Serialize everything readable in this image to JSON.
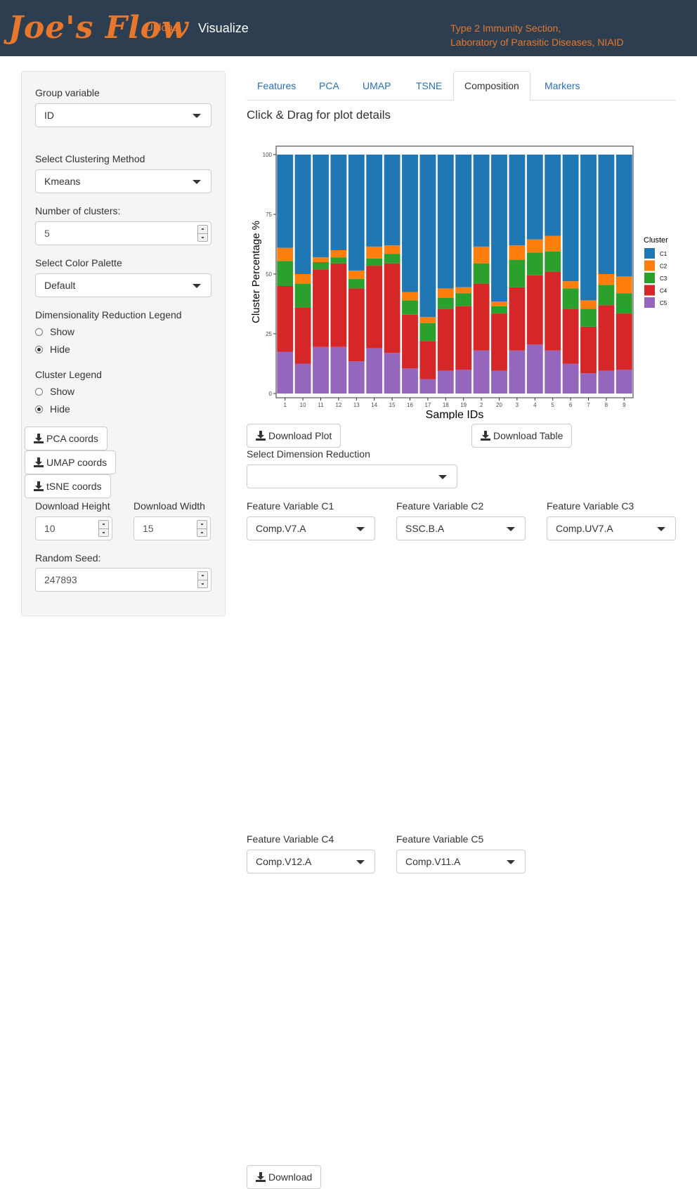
{
  "navbar": {
    "brand": "Joe's Flow",
    "upload": "Upload",
    "visualize": "Visualize",
    "org_line1": "Type 2 Immunity Section,",
    "org_line2": "Laboratory of Parasitic Diseases, NIAID"
  },
  "sidebar": {
    "group_label": "Group variable",
    "group_value": "ID",
    "clustering_label": "Select Clustering Method",
    "clustering_value": "Kmeans",
    "nclusters_label": "Number of clusters:",
    "nclusters_value": "5",
    "palette_label": "Select Color Palette",
    "palette_value": "Default",
    "dimred_legend_label": "Dimensionality Reduction Legend",
    "dimred_legend_options": [
      "Show",
      "Hide"
    ],
    "dimred_legend_selected": "Hide",
    "cluster_legend_label": "Cluster Legend",
    "cluster_legend_options": [
      "Show",
      "Hide"
    ],
    "cluster_legend_selected": "Hide",
    "pca_coords": "PCA coords",
    "umap_coords": "UMAP coords",
    "tsne_coords": "tSNE coords",
    "dl_height_label": "Download Height",
    "dl_height_value": "10",
    "dl_width_label": "Download Width",
    "dl_width_value": "15",
    "seed_label": "Random Seed:",
    "seed_value": "247893"
  },
  "tabs": [
    {
      "label": "Features"
    },
    {
      "label": "PCA"
    },
    {
      "label": "UMAP"
    },
    {
      "label": "TSNE"
    },
    {
      "label": "Composition"
    },
    {
      "label": "Markers"
    }
  ],
  "active_tab": "Composition",
  "main": {
    "heading": "Click & Drag for plot details",
    "download_plot": "Download Plot",
    "download_table": "Download Table",
    "dimred_label": "Select Dimension Reduction",
    "dimred_value": "",
    "fv_c1_label": "Feature Variable C1",
    "fv_c1_value": "Comp.V7.A",
    "fv_c2_label": "Feature Variable C2",
    "fv_c2_value": "SSC.B.A",
    "fv_c3_label": "Feature Variable C3",
    "fv_c3_value": "Comp.UV7.A",
    "fv_c4_label": "Feature Variable C4",
    "fv_c4_value": "Comp.V12.A",
    "fv_c5_label": "Feature Variable C5",
    "fv_c5_value": "Comp.V11.A",
    "download": "Download"
  },
  "colors": {
    "C1": "#1f77b4",
    "C2": "#ff7f0e",
    "C3": "#2ca02c",
    "C4": "#d62728",
    "C5": "#9467bd",
    "navbar_bg": "#2c3e50",
    "accent": "#e8772e"
  },
  "chart_data": {
    "type": "bar",
    "stacked": true,
    "xlabel": "Sample IDs",
    "ylabel": "Cluster Percentage %",
    "ylim": [
      0,
      100
    ],
    "yticks": [
      0,
      25,
      50,
      75,
      100
    ],
    "legend_title": "Cluster",
    "legend_position": "right",
    "categories": [
      "1",
      "10",
      "11",
      "12",
      "13",
      "14",
      "15",
      "16",
      "17",
      "18",
      "19",
      "2",
      "20",
      "3",
      "4",
      "5",
      "6",
      "7",
      "8",
      "9"
    ],
    "series": [
      {
        "name": "C5",
        "values": [
          17.5,
          12.5,
          19.5,
          19.5,
          13.5,
          19,
          17,
          10.5,
          6,
          9.5,
          10,
          18,
          9.5,
          18,
          20.5,
          18,
          12.5,
          8.5,
          9.5,
          10
        ]
      },
      {
        "name": "C4",
        "values": [
          27.5,
          23.5,
          32.5,
          35,
          30.5,
          34.5,
          37.5,
          22.5,
          16,
          26,
          26.5,
          28,
          24,
          26.5,
          29,
          33,
          23,
          19.5,
          27.5,
          23.5
        ]
      },
      {
        "name": "C3",
        "values": [
          10.5,
          10,
          3,
          2.5,
          4,
          3,
          4,
          6,
          7.5,
          4.5,
          5.5,
          8.5,
          3,
          11.5,
          9.5,
          8.5,
          8.5,
          7.5,
          8.5,
          8.5
        ]
      },
      {
        "name": "C2",
        "values": [
          5.5,
          4,
          2,
          3,
          3.5,
          5,
          3.5,
          3.5,
          2.5,
          4,
          2.5,
          7,
          2,
          6,
          5.5,
          6.5,
          3,
          3.5,
          4.5,
          7
        ]
      },
      {
        "name": "C1",
        "values": [
          39,
          50,
          43,
          40,
          48.5,
          38.5,
          38,
          57.5,
          68,
          56,
          55.5,
          38.5,
          61.5,
          38,
          35.5,
          34,
          53,
          61,
          50,
          51
        ]
      }
    ],
    "legend": [
      "C1",
      "C2",
      "C3",
      "C4",
      "C5"
    ],
    "grid": false
  }
}
